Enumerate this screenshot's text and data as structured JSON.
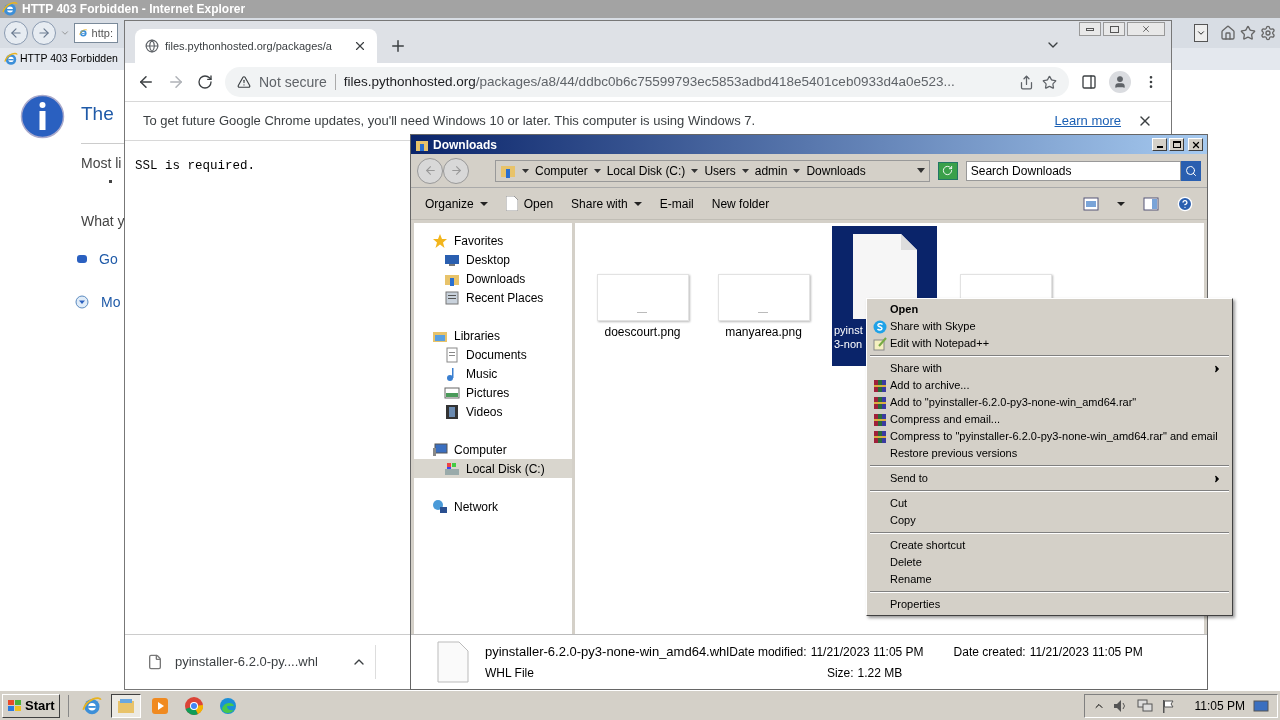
{
  "ie": {
    "title": "HTTP 403 Forbidden - Internet Explorer",
    "address": "http:",
    "tab": "HTTP 403 Forbidden",
    "heading": "The",
    "paragraphs": [
      "Most li",
      "What y"
    ],
    "links": [
      {
        "text": "Go",
        "kind": "bullet"
      },
      {
        "text": "Mo",
        "kind": "expand"
      }
    ]
  },
  "chrome": {
    "tab": "files.pythonhosted.org/packages/a",
    "security": "Not secure",
    "url_host": "files.pythonhosted.org",
    "url_path": "/packages/a8/44/ddbc0b6c75599793ec5853adbd418e5401ceb0933d4a0e523...",
    "infobar": {
      "text": "To get future Google Chrome updates, you'll need Windows 10 or later. This computer is using Windows 7.",
      "link": "Learn more"
    },
    "page_text": "SSL is required.",
    "download": "pyinstaller-6.2.0-py....whl"
  },
  "explorer": {
    "title": "Downloads",
    "breadcrumbs": [
      "Computer",
      "Local Disk (C:)",
      "Users",
      "admin",
      "Downloads"
    ],
    "search_placeholder": "Search Downloads",
    "toolbar": [
      {
        "label": "Organize",
        "kind": "menu"
      },
      {
        "label": "Open",
        "kind": "file"
      },
      {
        "label": "Share with",
        "kind": "menu"
      },
      {
        "label": "E-mail",
        "kind": "plain"
      },
      {
        "label": "New folder",
        "kind": "plain"
      }
    ],
    "nav": [
      {
        "label": "Favorites",
        "kind": "star",
        "selected": false,
        "children": [
          {
            "label": "Desktop",
            "kind": "desktop",
            "selected": false
          },
          {
            "label": "Downloads",
            "kind": "folder",
            "selected": false
          },
          {
            "label": "Recent Places",
            "kind": "recent",
            "selected": false
          }
        ]
      },
      {
        "label": "Libraries",
        "kind": "library",
        "selected": false,
        "children": [
          {
            "label": "Documents",
            "kind": "doc",
            "selected": false
          },
          {
            "label": "Music",
            "kind": "music",
            "selected": false
          },
          {
            "label": "Pictures",
            "kind": "pictures",
            "selected": false
          },
          {
            "label": "Videos",
            "kind": "videos",
            "selected": false
          }
        ]
      },
      {
        "label": "Computer",
        "kind": "computer",
        "selected": false,
        "children": [
          {
            "label": "Local Disk (C:)",
            "kind": "disk",
            "selected": true
          }
        ]
      },
      {
        "label": "Network",
        "kind": "network",
        "selected": false
      }
    ],
    "files": [
      {
        "name_lines": [
          "doescourt.png"
        ],
        "kind": "image",
        "selected": false
      },
      {
        "name_lines": [
          "manyarea.png"
        ],
        "kind": "image",
        "selected": false
      },
      {
        "name_lines": [
          "pyinst",
          "3-non"
        ],
        "kind": "document",
        "selected": true
      },
      {
        "kind": "image",
        "selected": false
      }
    ],
    "details": {
      "name": "pyinstaller-6.2.0-py3-none-win_amd64.whl",
      "type": "WHL File",
      "fields": [
        {
          "label": "Date modified:",
          "value": "11/21/2023 11:05 PM"
        },
        {
          "label": "Size:",
          "value": "1.22 MB"
        },
        {
          "label": "Date created:",
          "value": "11/21/2023 11:05 PM"
        }
      ]
    }
  },
  "context_menu": [
    [
      {
        "label": "Open",
        "kind": "plain",
        "default": true,
        "submenu": false
      },
      {
        "label": "Share with Skype",
        "kind": "skype",
        "default": false,
        "submenu": false
      },
      {
        "label": "Edit with Notepad++",
        "kind": "notepad",
        "default": false,
        "submenu": false
      }
    ],
    [
      {
        "label": "Share with",
        "kind": "plain",
        "default": false,
        "submenu": true
      },
      {
        "label": "Add to archive...",
        "kind": "winrar",
        "default": false,
        "submenu": false
      },
      {
        "label": "Add to \"pyinstaller-6.2.0-py3-none-win_amd64.rar\"",
        "kind": "winrar",
        "default": false,
        "submenu": false
      },
      {
        "label": "Compress and email...",
        "kind": "winrar",
        "default": false,
        "submenu": false
      },
      {
        "label": "Compress to \"pyinstaller-6.2.0-py3-none-win_amd64.rar\" and email",
        "kind": "winrar",
        "default": false,
        "submenu": false
      },
      {
        "label": "Restore previous versions",
        "kind": "plain",
        "default": false,
        "submenu": false
      }
    ],
    [
      {
        "label": "Send to",
        "kind": "plain",
        "default": false,
        "submenu": true
      }
    ],
    [
      {
        "label": "Cut",
        "kind": "plain",
        "default": false,
        "submenu": false
      },
      {
        "label": "Copy",
        "kind": "plain",
        "default": false,
        "submenu": false
      }
    ],
    [
      {
        "label": "Create shortcut",
        "kind": "plain",
        "default": false,
        "submenu": false
      },
      {
        "label": "Delete",
        "kind": "plain",
        "default": false,
        "submenu": false
      },
      {
        "label": "Rename",
        "kind": "plain",
        "default": false,
        "submenu": false
      }
    ],
    [
      {
        "label": "Properties",
        "kind": "plain",
        "default": false,
        "submenu": false
      }
    ]
  ],
  "taskbar": {
    "start": "Start",
    "apps": [
      {
        "kind": "ie",
        "selected": false
      },
      {
        "kind": "explorer",
        "selected": true
      },
      {
        "kind": "media",
        "selected": false
      },
      {
        "kind": "chrome",
        "selected": false
      },
      {
        "kind": "edge",
        "selected": false
      }
    ],
    "clock": "11:05 PM"
  }
}
